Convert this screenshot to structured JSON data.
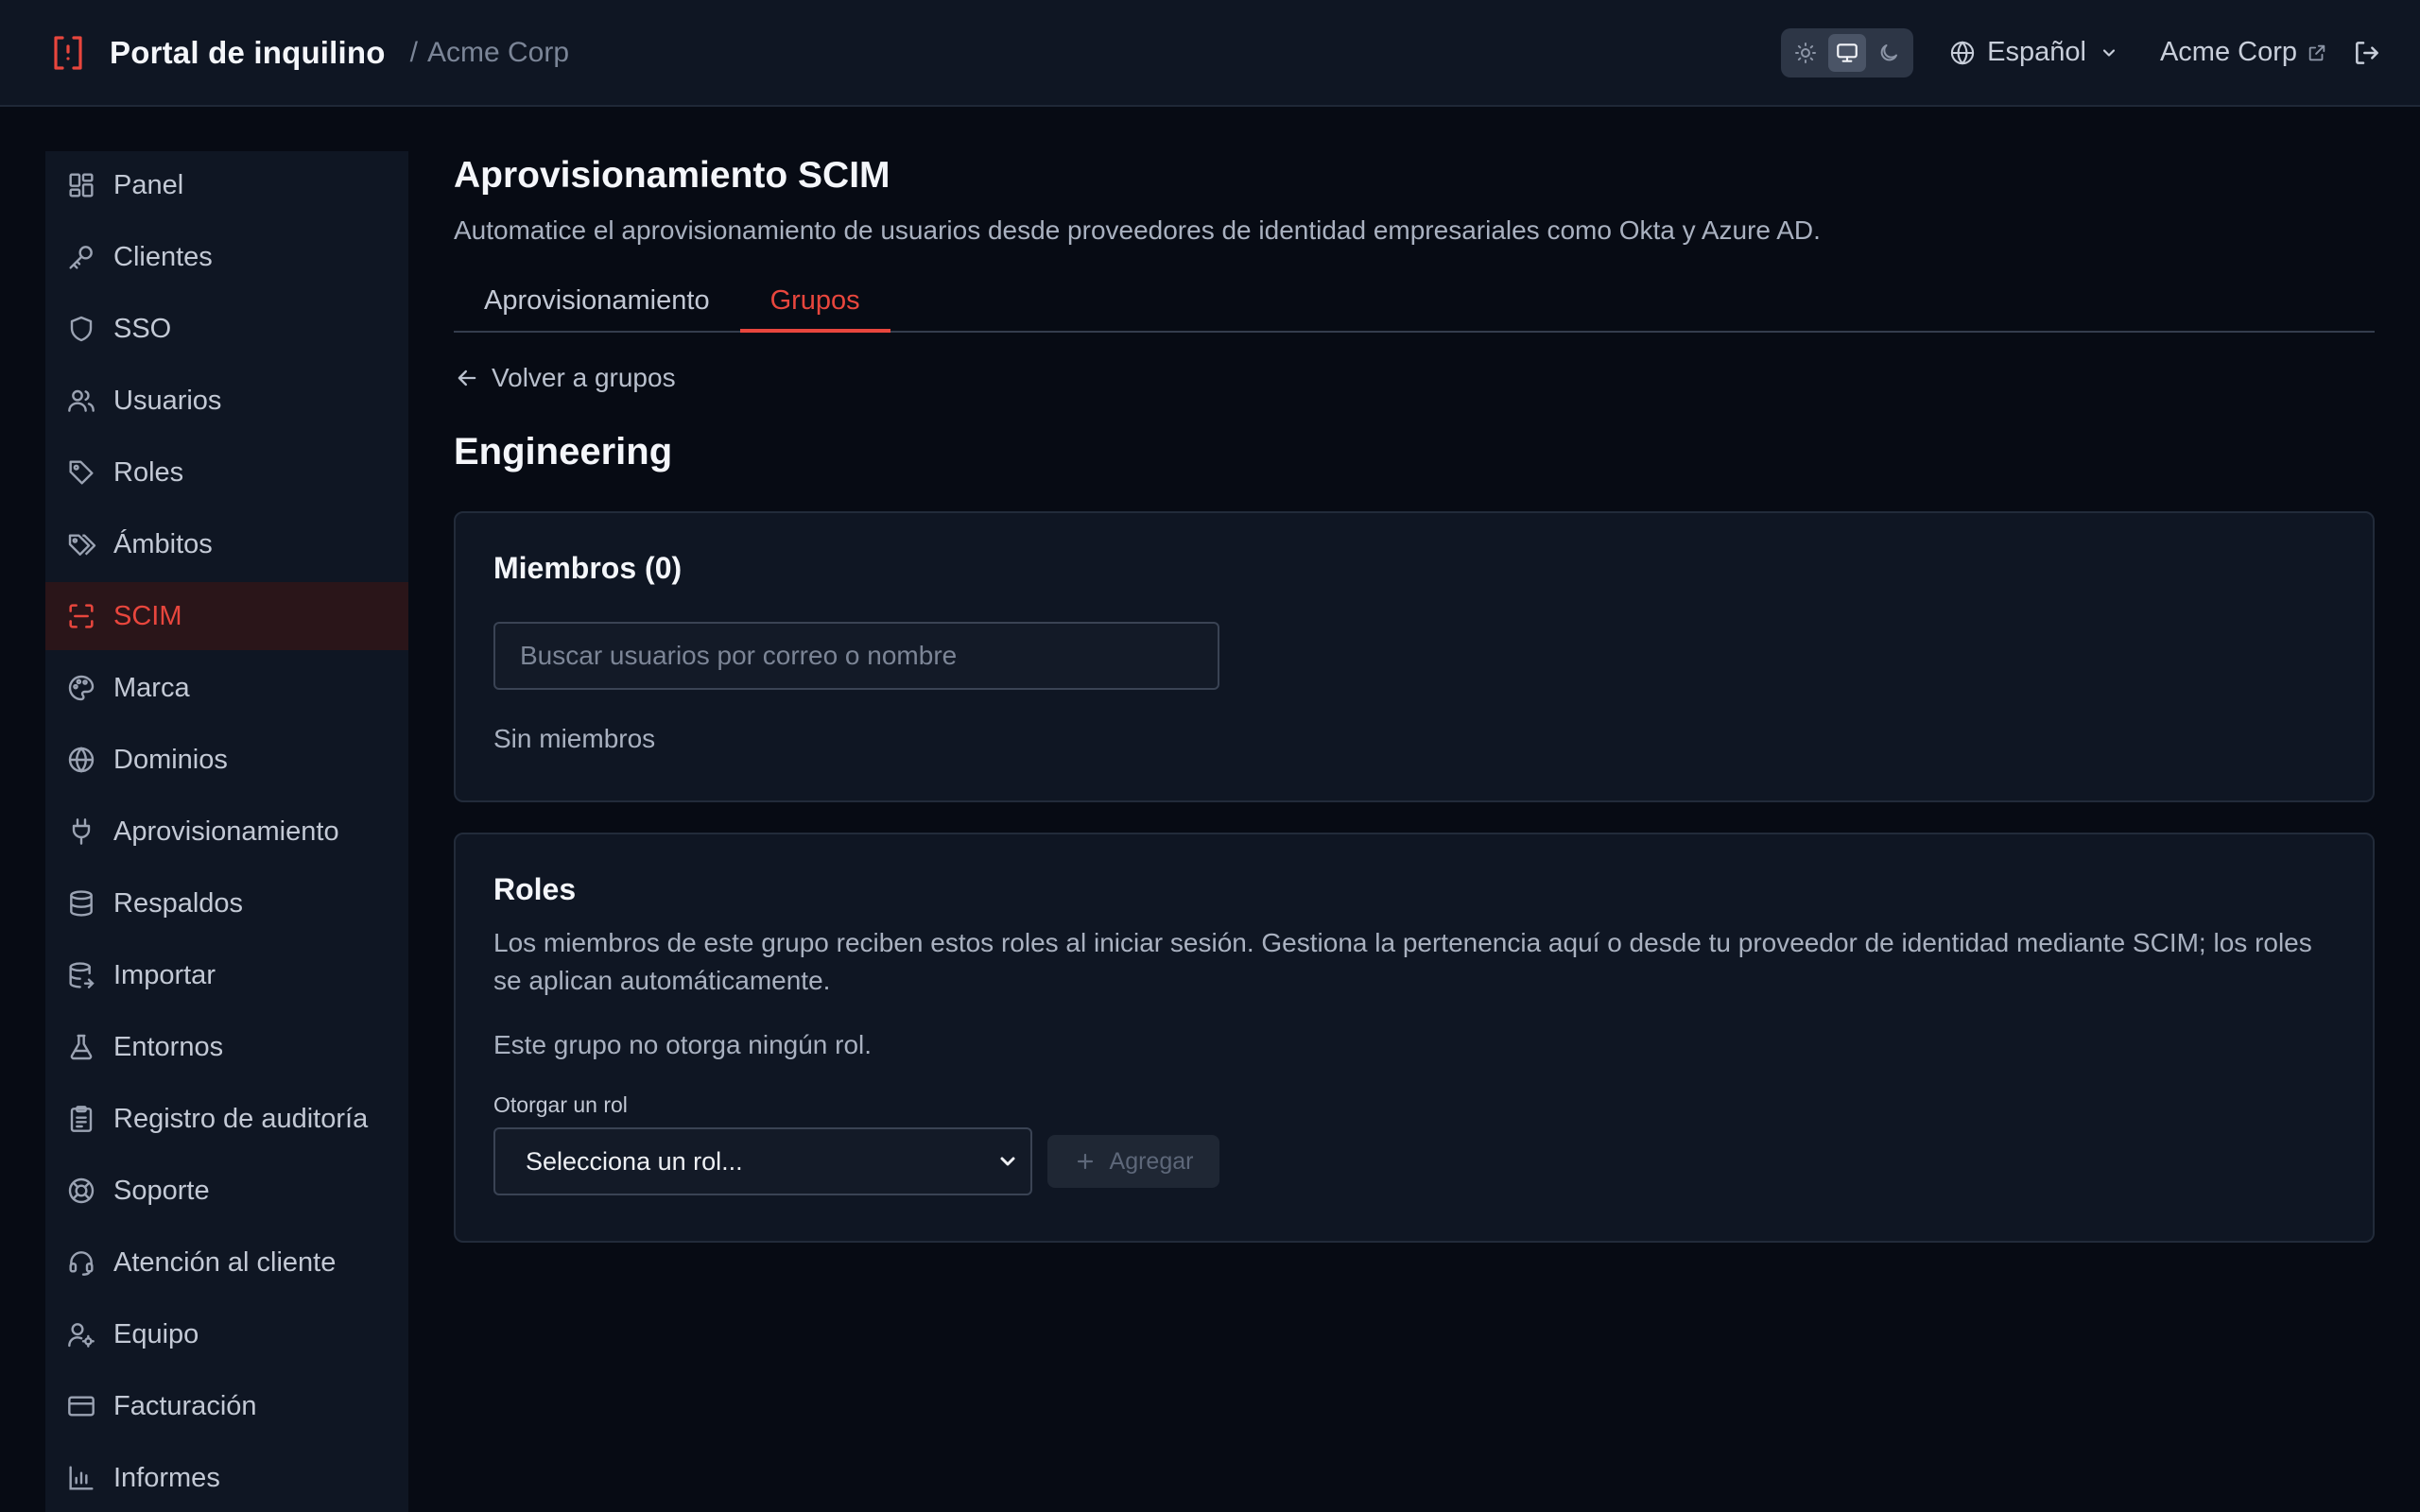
{
  "header": {
    "brand_title": "Portal de inquilino",
    "separator": "/",
    "tenant": "Acme Corp",
    "theme_modes": [
      "sun-icon",
      "monitor-icon",
      "moon-icon"
    ],
    "theme_active": "monitor-icon",
    "language": "Español",
    "tenant_link": "Acme Corp"
  },
  "sidebar": {
    "items": [
      {
        "label": "Panel",
        "icon": "dashboard-icon"
      },
      {
        "label": "Clientes",
        "icon": "key-icon"
      },
      {
        "label": "SSO",
        "icon": "shield-icon"
      },
      {
        "label": "Usuarios",
        "icon": "users-icon"
      },
      {
        "label": "Roles",
        "icon": "tag-icon"
      },
      {
        "label": "Ámbitos",
        "icon": "tags-icon"
      },
      {
        "label": "SCIM",
        "icon": "scan-icon",
        "active": true
      },
      {
        "label": "Marca",
        "icon": "palette-icon"
      },
      {
        "label": "Dominios",
        "icon": "globe-icon"
      },
      {
        "label": "Aprovisionamiento",
        "icon": "plug-icon"
      },
      {
        "label": "Respaldos",
        "icon": "database-icon"
      },
      {
        "label": "Importar",
        "icon": "database-import-icon"
      },
      {
        "label": "Entornos",
        "icon": "flask-icon"
      },
      {
        "label": "Registro de auditoría",
        "icon": "clipboard-icon"
      },
      {
        "label": "Soporte",
        "icon": "lifebuoy-icon"
      },
      {
        "label": "Atención al cliente",
        "icon": "headset-icon"
      },
      {
        "label": "Equipo",
        "icon": "user-cog-icon"
      },
      {
        "label": "Facturación",
        "icon": "credit-card-icon"
      },
      {
        "label": "Informes",
        "icon": "bar-chart-icon"
      }
    ]
  },
  "main": {
    "title": "Aprovisionamiento SCIM",
    "subtitle": "Automatice el aprovisionamiento de usuarios desde proveedores de identidad empresariales como Okta y Azure AD.",
    "tabs": [
      {
        "label": "Aprovisionamiento",
        "active": false
      },
      {
        "label": "Grupos",
        "active": true
      }
    ],
    "back_link": "Volver a grupos",
    "group_name": "Engineering",
    "members": {
      "title": "Miembros (0)",
      "search_placeholder": "Buscar usuarios por correo o nombre",
      "empty": "Sin miembros"
    },
    "roles": {
      "title": "Roles",
      "description": "Los miembros de este grupo reciben estos roles al iniciar sesión. Gestiona la pertenencia aquí o desde tu proveedor de identidad mediante SCIM; los roles se aplican automáticamente.",
      "empty": "Este grupo no otorga ningún rol.",
      "grant_label": "Otorgar un rol",
      "select_value": "Selecciona un rol...",
      "add_label": "Agregar"
    }
  },
  "colors": {
    "accent": "#e8463d",
    "background": "#070b14",
    "panel": "#0f1623"
  }
}
